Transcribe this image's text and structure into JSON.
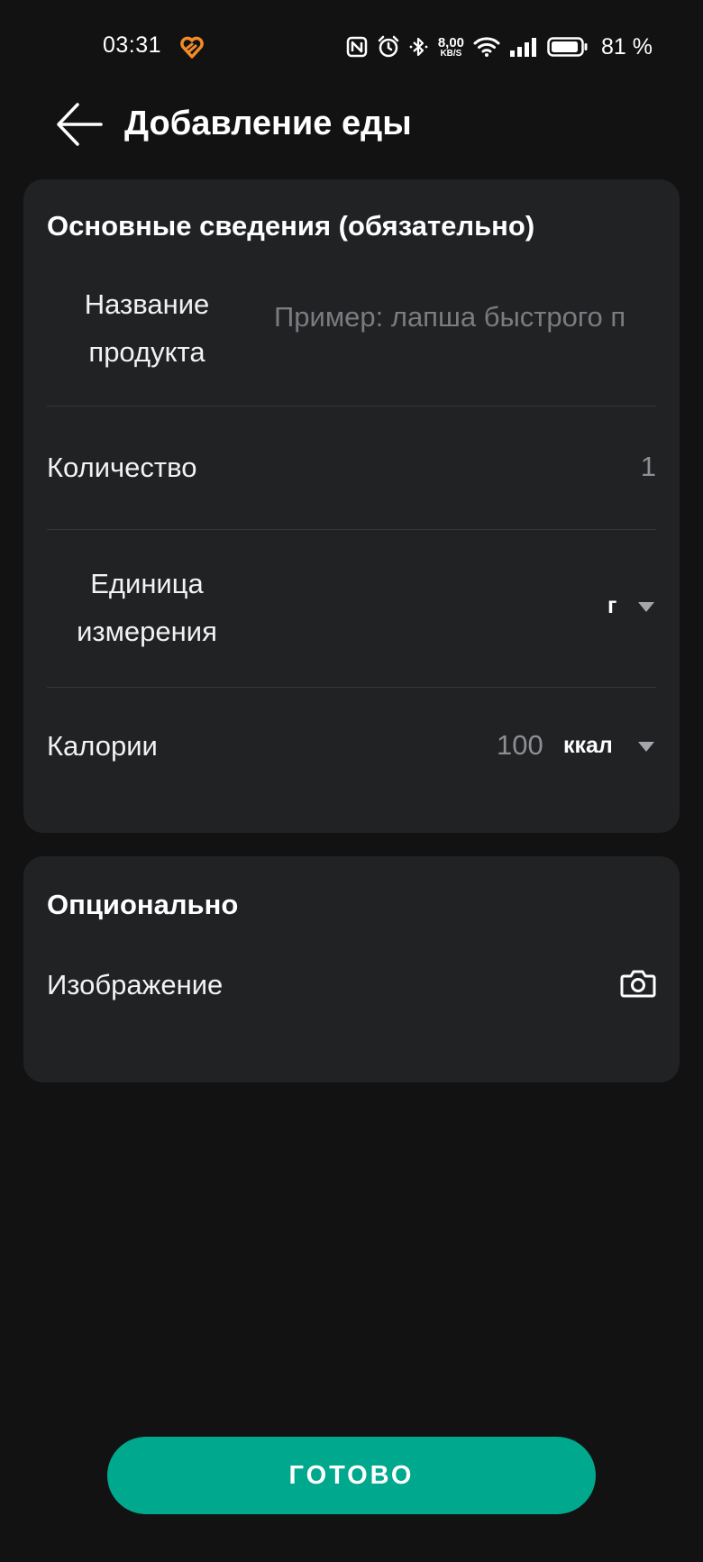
{
  "status_bar": {
    "time": "03:31",
    "net_speed_value": "8,00",
    "net_speed_unit": "KB/S",
    "battery_percent": "81 %",
    "app_icon": "heart-icon",
    "icons": [
      "nfc-icon",
      "alarm-icon",
      "bluetooth-icon",
      "wifi-icon",
      "signal-icon",
      "battery-icon"
    ]
  },
  "header": {
    "title": "Добавление еды",
    "back_icon": "arrow-left-icon"
  },
  "basic_section": {
    "title": "Основные сведения (обязательно)",
    "product_name": {
      "label": "Название продукта",
      "placeholder": "Пример: лапша быстрого п"
    },
    "quantity": {
      "label": "Количество",
      "value": "1"
    },
    "unit": {
      "label": "Единица измерения",
      "value": "г"
    },
    "calories": {
      "label": "Калории",
      "value": "100",
      "unit": "ккал"
    }
  },
  "optional_section": {
    "title": "Опционально",
    "image": {
      "label": "Изображение",
      "icon": "camera-icon"
    }
  },
  "done_button": {
    "label": "ГОТОВО"
  },
  "colors": {
    "background": "#121212",
    "card": "#212224",
    "accent": "#00a88e",
    "app_icon": "#f28c28"
  }
}
